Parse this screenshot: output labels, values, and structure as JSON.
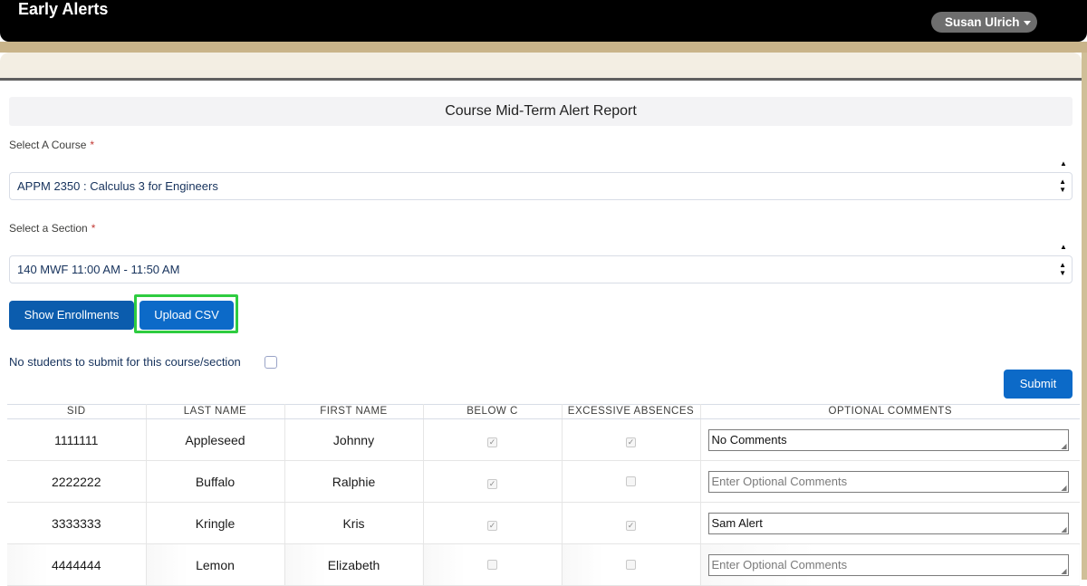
{
  "app": {
    "title": "Early Alerts",
    "user": "Susan Ulrich"
  },
  "report": {
    "title": "Course Mid-Term Alert Report"
  },
  "course_field": {
    "label": "Select A Course",
    "required_mark": "*",
    "value": "APPM 2350 : Calculus 3 for Engineers"
  },
  "section_field": {
    "label": "Select a Section",
    "required_mark": "*",
    "value": "140 MWF 11:00 AM - 11:50 AM"
  },
  "buttons": {
    "show_enrollments": "Show Enrollments",
    "upload_csv": "Upload CSV",
    "submit": "Submit"
  },
  "no_students_label": "No students to submit for this course/section",
  "table": {
    "headers": [
      "SID",
      "LAST NAME",
      "FIRST NAME",
      "BELOW C",
      "EXCESSIVE ABSENCES",
      "OPTIONAL COMMENTS"
    ],
    "comment_placeholder": "Enter Optional Comments",
    "rows": [
      {
        "sid": "1111111",
        "last": "Appleseed",
        "first": "Johnny",
        "below_c": true,
        "absences": true,
        "comment": "No Comments"
      },
      {
        "sid": "2222222",
        "last": "Buffalo",
        "first": "Ralphie",
        "below_c": true,
        "absences": false,
        "comment": ""
      },
      {
        "sid": "3333333",
        "last": "Kringle",
        "first": "Kris",
        "below_c": true,
        "absences": true,
        "comment": "Sam Alert"
      },
      {
        "sid": "4444444",
        "last": "Lemon",
        "first": "Elizabeth",
        "below_c": false,
        "absences": false,
        "comment": ""
      }
    ]
  },
  "colors": {
    "primary_button": "#0c6ac8",
    "highlight_border": "#2ecc40",
    "header_bar": "#000000",
    "accent_tan": "#c9b48a"
  }
}
